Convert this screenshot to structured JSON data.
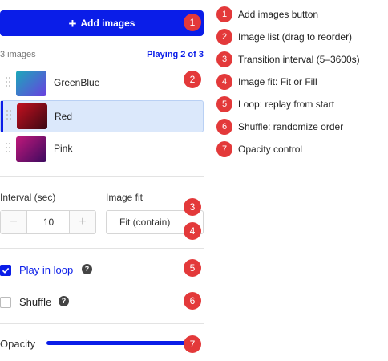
{
  "panel": {
    "add_button": {
      "icon": "plus-icon",
      "label": "Add images"
    },
    "image_count": "3 images",
    "playing": "Playing 2 of 3",
    "images": [
      {
        "name": "GreenBlue",
        "active": false
      },
      {
        "name": "Red",
        "active": true
      },
      {
        "name": "Pink",
        "active": false
      }
    ],
    "interval": {
      "label": "Interval (sec)",
      "value": "10",
      "minus": "−",
      "plus": "+"
    },
    "image_fit": {
      "label": "Image fit",
      "value": "Fit (contain)"
    },
    "play_in_loop": {
      "label": "Play in loop",
      "checked": true
    },
    "shuffle": {
      "label": "Shuffle",
      "checked": false
    },
    "help_glyph": "?",
    "opacity": {
      "label": "Opacity",
      "value_fraction": 1.0
    }
  },
  "badges": [
    "1",
    "2",
    "3",
    "4",
    "5",
    "6",
    "7"
  ],
  "legend": [
    {
      "num": "1",
      "text": "Add images button"
    },
    {
      "num": "2",
      "text": "Image list (drag to reorder)"
    },
    {
      "num": "3",
      "text": "Transition interval (5–3600s)"
    },
    {
      "num": "4",
      "text": "Image fit: Fit or Fill"
    },
    {
      "num": "5",
      "text": "Loop: replay from start"
    },
    {
      "num": "6",
      "text": "Shuffle: randomize order"
    },
    {
      "num": "7",
      "text": "Opacity control"
    }
  ],
  "colors": {
    "accent": "#0a1de8",
    "badge": "#e3393a",
    "active_row": "#dbe8fb",
    "thumb_greenblue": [
      "#1aa9b9",
      "#6a3fe0"
    ],
    "thumb_red": [
      "#c4101f",
      "#3a0813"
    ],
    "thumb_pink": [
      "#c0187a",
      "#3c0a5f"
    ]
  }
}
